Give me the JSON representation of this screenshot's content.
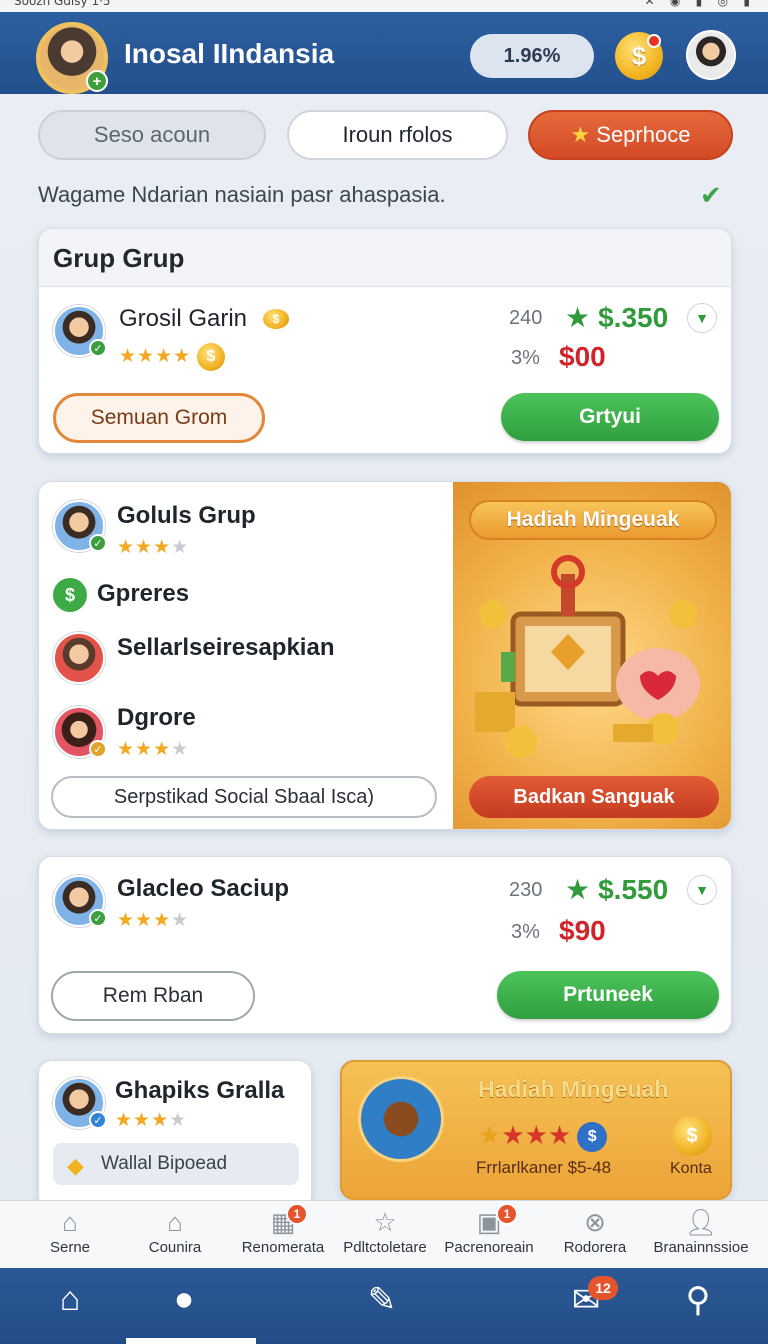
{
  "status_bar": {
    "left_text": "Soozh  Gdisy 1·5"
  },
  "header": {
    "title": "Inosal IIndansia",
    "percent": "1.96%",
    "coin_symbol": "$"
  },
  "tabs": [
    {
      "label": "Seso acoun"
    },
    {
      "label": "Iroun rfolos"
    },
    {
      "label": "Seprhoce"
    }
  ],
  "info_line": "Wagame Ndarian nasiain pasr ahaspasia.",
  "card1": {
    "header": "Grup Grup",
    "name": "Grosil Garin",
    "count": "240",
    "percent": "3%",
    "price_green": "$.350",
    "price_red": "$00",
    "rating": 4,
    "outline_button": "Semuan Grom",
    "green_button": "Grtyui"
  },
  "card2": {
    "name": "Goluls Grup",
    "rating": 3,
    "section_label": "Gpreres",
    "person1_name": "Sellarlseiresapkian",
    "person2_name": "Dgrore",
    "person2_rating": 3,
    "input_label": "Serpstikad  Social Sbaal Isca)",
    "reward_title": "Hadiah Mingeuak",
    "reward_button": "Badkan Sanguak"
  },
  "card3": {
    "name": "Glacleo Saciup",
    "rating": 3,
    "count": "230",
    "percent": "3%",
    "price_green": "$.550",
    "price_red": "$90",
    "outline_button": "Rem Rban",
    "green_button": "Prtuneek"
  },
  "card4": {
    "name": "Ghapiks Gralla",
    "rating": 3,
    "tag": "Wallal Bipoead"
  },
  "card5": {
    "title": "Hadiah Mingeuah",
    "label": "Frrlarlkaner  $5-48",
    "coin_label": "Konta"
  },
  "bottom_nav": [
    {
      "label": "Serne",
      "badge": ""
    },
    {
      "label": "Counira",
      "badge": ""
    },
    {
      "label": "Renomerata",
      "badge": "1"
    },
    {
      "label": "Pdltctoletare",
      "badge": ""
    },
    {
      "label": "Pacrenoreain",
      "badge": "1"
    },
    {
      "label": "Rodorera",
      "badge": ""
    },
    {
      "label": "Branainnssioe",
      "badge": ""
    }
  ],
  "tab_bar": {
    "badge": "12"
  },
  "colors": {
    "header": "#2d5fa1",
    "accent_orange": "#d44a26",
    "green": "#2f9b3a",
    "red": "#d0242a",
    "gold": "#f3b521"
  }
}
